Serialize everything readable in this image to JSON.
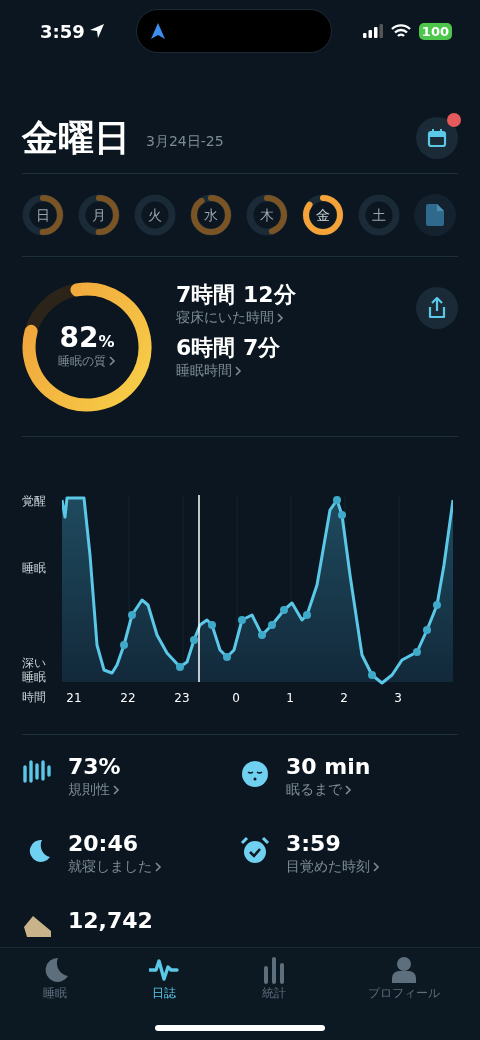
{
  "status_bar": {
    "time": "3:59",
    "battery": "100"
  },
  "header": {
    "title": "金曜日",
    "date_range": "3月24日-25",
    "calendar_badge": true
  },
  "days": [
    {
      "label": "日",
      "selected": false
    },
    {
      "label": "月",
      "selected": false
    },
    {
      "label": "火",
      "selected": false
    },
    {
      "label": "水",
      "selected": false
    },
    {
      "label": "木",
      "selected": false
    },
    {
      "label": "金",
      "selected": true
    },
    {
      "label": "土",
      "selected": false
    }
  ],
  "summary": {
    "score": "82",
    "score_unit": "%",
    "score_label": "睡眠の質",
    "metrics": [
      {
        "value": "7時間 12分",
        "label": "寝床にいた時間"
      },
      {
        "value": "6時間 7分",
        "label": "睡眠時間"
      }
    ]
  },
  "sleep_graph": {
    "y_labels": [
      "覚醒",
      "睡眠",
      "深い睡眠"
    ],
    "x_title": "時間",
    "x_labels": [
      "21",
      "22",
      "23",
      "0",
      "1",
      "2",
      "3"
    ]
  },
  "stats": [
    {
      "kind": "regularity",
      "value": "73%",
      "label": "規則性"
    },
    {
      "kind": "fall_asleep",
      "value": "30 min",
      "label": "眠るまで"
    },
    {
      "kind": "bedtime",
      "value": "20:46",
      "label": "就寝しました"
    },
    {
      "kind": "wakeup",
      "value": "3:59",
      "label": "目覚めた時刻"
    },
    {
      "kind": "steps",
      "value": "12,742"
    }
  ],
  "tabs": [
    {
      "kind": "sleep",
      "label": "睡眠",
      "selected": false
    },
    {
      "kind": "journal",
      "label": "日誌",
      "selected": true
    },
    {
      "kind": "stats",
      "label": "統計",
      "selected": false
    },
    {
      "kind": "profile",
      "label": "プロフィール",
      "selected": false
    }
  ]
}
